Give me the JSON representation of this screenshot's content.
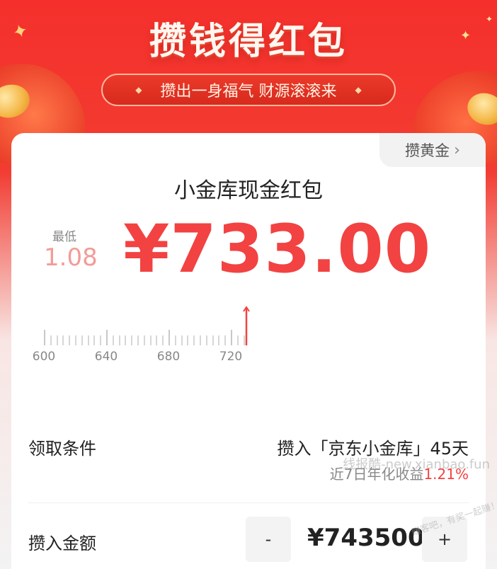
{
  "header": {
    "title": "攒钱得红包",
    "subtitle": "攒出一身福气 财源滚滚来"
  },
  "card": {
    "tag_label": "攒黄金",
    "title": "小金库现金红包",
    "min_label": "最低",
    "min_value": "1.08",
    "amount": "¥733.00",
    "ruler": {
      "labels": [
        "600",
        "640",
        "680",
        "720"
      ],
      "start_value": 600,
      "end_value": 730,
      "pointer_value": 733
    }
  },
  "conditions": {
    "label": "领取条件",
    "value": "攒入「京东小金库」45天",
    "yield_label": "近7日年化收益",
    "yield_rate": "1.21%",
    "watermark": "线报酷-new.xianbao.fun"
  },
  "deposit": {
    "label": "攒入金额",
    "minus": "-",
    "value": "¥743500",
    "plus": "+",
    "watermark": "赚客吧，有奖一起赚！ zuanke8.com"
  },
  "colors": {
    "accent": "#f24242",
    "banner": "#f5302c"
  }
}
